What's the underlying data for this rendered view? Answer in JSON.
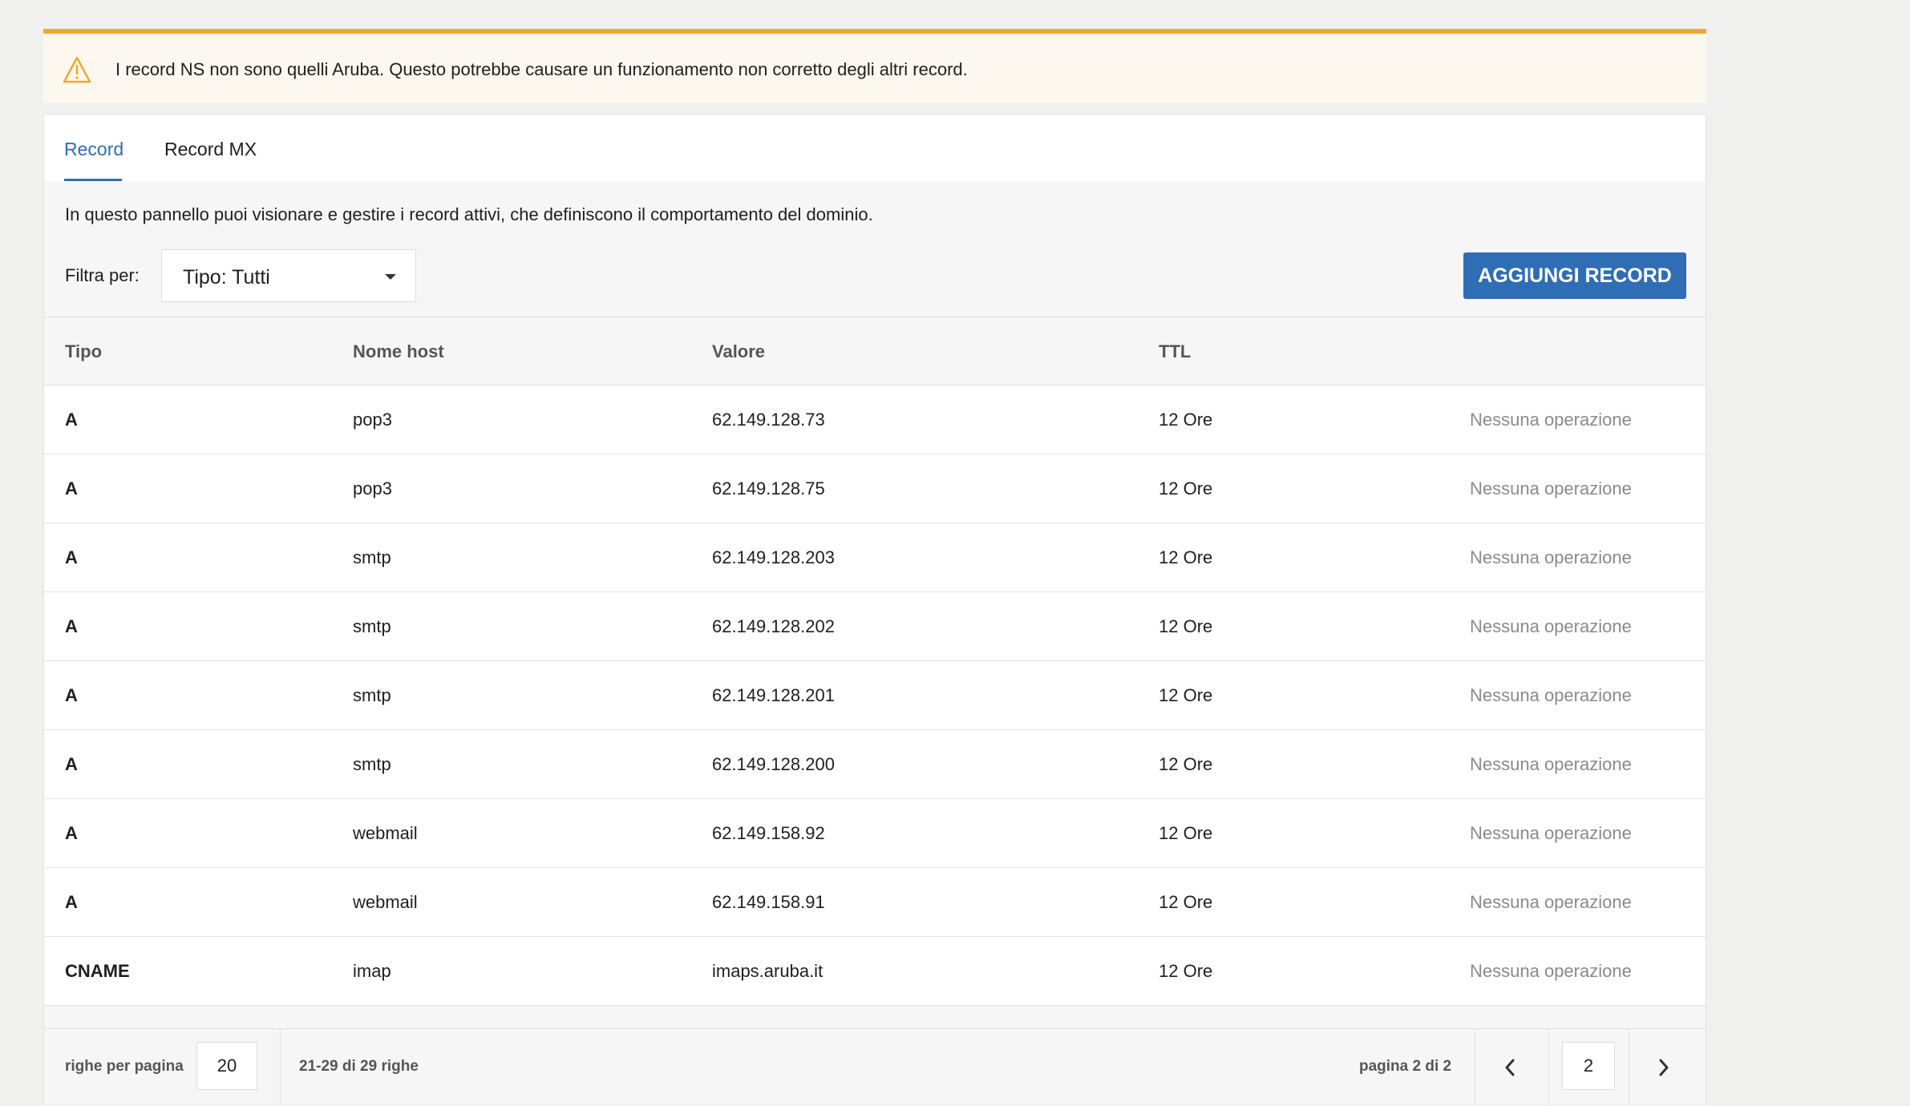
{
  "warning": {
    "icon": "warning-triangle-icon",
    "text": "I record NS non sono quelli Aruba. Questo potrebbe causare un funzionamento non corretto degli altri record."
  },
  "tabs": [
    {
      "label": "Record",
      "active": true
    },
    {
      "label": "Record MX",
      "active": false
    }
  ],
  "description": "In questo pannello puoi visionare e gestire i record attivi, che definiscono il comportamento del dominio.",
  "filter": {
    "label": "Filtra per:",
    "selected": "Tipo: Tutti"
  },
  "add_button": "AGGIUNGI RECORD",
  "table": {
    "headers": [
      "Tipo",
      "Nome host",
      "Valore",
      "TTL"
    ],
    "rows": [
      {
        "type": "A",
        "host": "pop3",
        "value": "62.149.128.73",
        "ttl": "12 Ore",
        "op": "Nessuna operazione"
      },
      {
        "type": "A",
        "host": "pop3",
        "value": "62.149.128.75",
        "ttl": "12 Ore",
        "op": "Nessuna operazione"
      },
      {
        "type": "A",
        "host": "smtp",
        "value": "62.149.128.203",
        "ttl": "12 Ore",
        "op": "Nessuna operazione"
      },
      {
        "type": "A",
        "host": "smtp",
        "value": "62.149.128.202",
        "ttl": "12 Ore",
        "op": "Nessuna operazione"
      },
      {
        "type": "A",
        "host": "smtp",
        "value": "62.149.128.201",
        "ttl": "12 Ore",
        "op": "Nessuna operazione"
      },
      {
        "type": "A",
        "host": "smtp",
        "value": "62.149.128.200",
        "ttl": "12 Ore",
        "op": "Nessuna operazione"
      },
      {
        "type": "A",
        "host": "webmail",
        "value": "62.149.158.92",
        "ttl": "12 Ore",
        "op": "Nessuna operazione"
      },
      {
        "type": "A",
        "host": "webmail",
        "value": "62.149.158.91",
        "ttl": "12 Ore",
        "op": "Nessuna operazione"
      },
      {
        "type": "CNAME",
        "host": "imap",
        "value": "imaps.aruba.it",
        "ttl": "12 Ore",
        "op": "Nessuna operazione"
      }
    ]
  },
  "pagination": {
    "rows_per_page_label": "righe per pagina",
    "rows_per_page": "20",
    "range": "21-29 di 29 righe",
    "page_label": "pagina 2 di 2",
    "current_page": "2",
    "prev_icon": "chevron-left-icon",
    "next_icon": "chevron-right-icon"
  },
  "colors": {
    "accent": "#2f6db5",
    "warning_border": "#f0a830",
    "warning_bg": "#fdf8ef"
  }
}
